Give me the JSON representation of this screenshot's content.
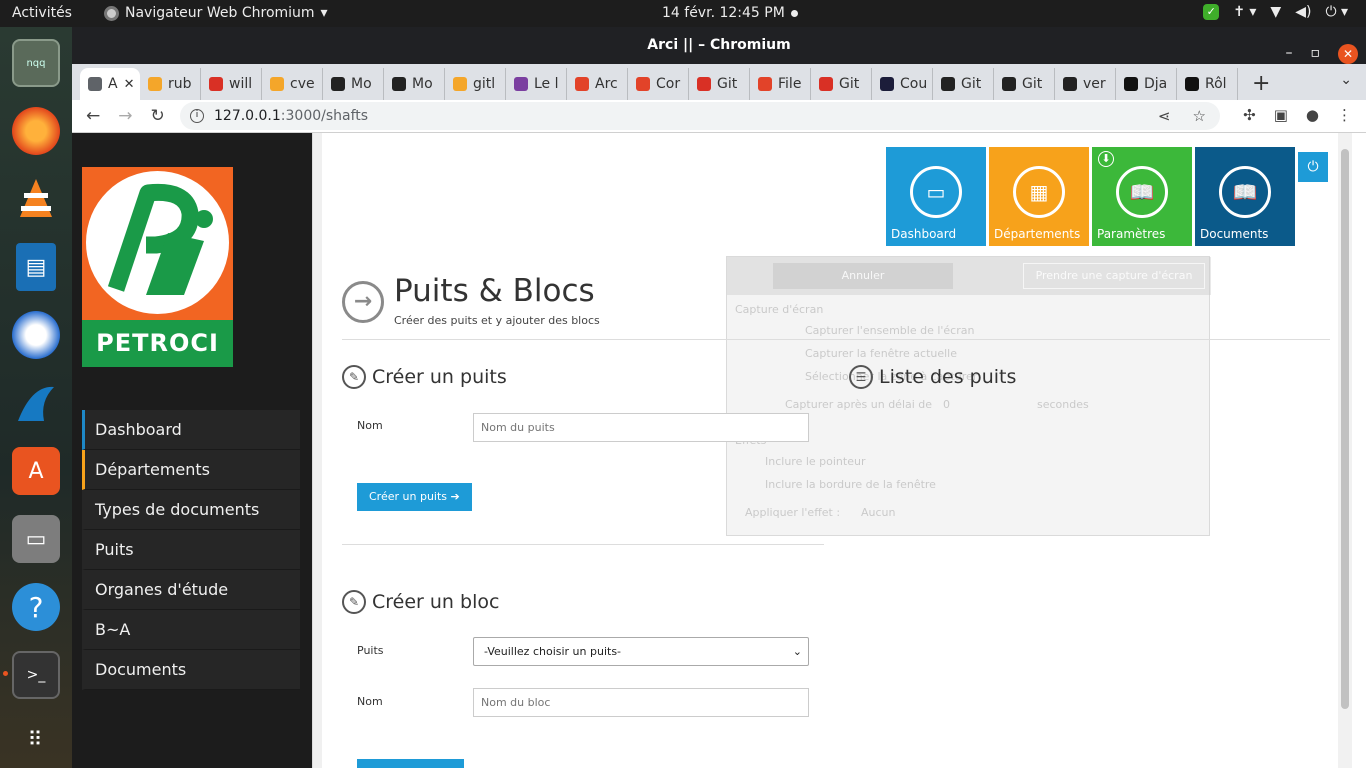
{
  "system": {
    "activities": "Activités",
    "app_menu": "Navigateur Web Chromium",
    "clock": "14 févr.  12:45 PM"
  },
  "dock": {
    "items": [
      "nqq-icon",
      "firefox-icon",
      "vlc-icon",
      "writer-icon",
      "thunderbird-icon",
      "wireshark-icon",
      "software-icon",
      "files-icon",
      "help-icon",
      "terminal-icon",
      "apps-grid-icon"
    ],
    "nqq_label": "nqq"
  },
  "browser": {
    "window_title": "Arci || – Chromium",
    "tabs": [
      {
        "label": "A",
        "color": "#5f6368",
        "active": true
      },
      {
        "label": "rub",
        "color": "#f4a62a"
      },
      {
        "label": "will",
        "color": "#d93025"
      },
      {
        "label": "cve",
        "color": "#f4a62a"
      },
      {
        "label": "Mo",
        "color": "#222222"
      },
      {
        "label": "Mo",
        "color": "#222222"
      },
      {
        "label": "gitl",
        "color": "#f4a62a"
      },
      {
        "label": "Le l",
        "color": "#7b3fa0"
      },
      {
        "label": "Arc",
        "color": "#e24329"
      },
      {
        "label": "Cor",
        "color": "#e24329"
      },
      {
        "label": "Git",
        "color": "#d93025"
      },
      {
        "label": "File",
        "color": "#e24329"
      },
      {
        "label": "Git",
        "color": "#d93025"
      },
      {
        "label": "Cou",
        "color": "#1c1d3a"
      },
      {
        "label": "Git",
        "color": "#222222"
      },
      {
        "label": "Git",
        "color": "#222222"
      },
      {
        "label": "ver",
        "color": "#222222"
      },
      {
        "label": "Dja",
        "color": "#111111"
      },
      {
        "label": "Rôl",
        "color": "#111111"
      }
    ],
    "new_tab": "+",
    "url_host": "127.0.0.1",
    "url_path": ":3000/shafts"
  },
  "sidebar": {
    "logo_text": "PETROCI",
    "items": [
      {
        "label": "Dashboard",
        "accent": "blue"
      },
      {
        "label": "Départements",
        "accent": "orange"
      },
      {
        "label": "Types de documents",
        "accent": "none"
      },
      {
        "label": "Puits",
        "accent": "none"
      },
      {
        "label": "Organes d'étude",
        "accent": "none"
      },
      {
        "label": "B~A",
        "accent": "none"
      },
      {
        "label": "Documents",
        "accent": "none"
      }
    ]
  },
  "tiles": [
    {
      "label": "Dashboard",
      "color": "#1e9bd7",
      "icon": "monitor-icon"
    },
    {
      "label": "Départements",
      "color": "#f7a21b",
      "icon": "grid-icon"
    },
    {
      "label": "Paramètres",
      "color": "#3cb83a",
      "icon": "book-icon"
    },
    {
      "label": "Documents",
      "color": "#0b5a8a",
      "icon": "book-icon"
    }
  ],
  "page": {
    "title": "Puits & Blocs",
    "subtitle": "Créer des puits et y ajouter des blocs",
    "create_well": {
      "title": "Créer un puits",
      "name_label": "Nom",
      "name_placeholder": "Nom du puits",
      "button": "Créer un puits"
    },
    "list_wells": {
      "title": "Liste des puits"
    },
    "create_block": {
      "title": "Créer un bloc",
      "well_label": "Puits",
      "well_select": "-Veuillez choisir un puits-",
      "name_label": "Nom",
      "name_placeholder": "Nom du bloc"
    }
  },
  "ghost_dialog": {
    "cancel": "Annuler",
    "take": "Prendre une capture d'écran",
    "section_capture": "Capture d'écran",
    "opt_full": "Capturer l'ensemble de l'écran",
    "opt_window": "Capturer la fenêtre actuelle",
    "opt_area": "Sélectionner la zone à capturer",
    "delay_label": "Capturer après un délai de",
    "delay_value": "0",
    "delay_unit": "secondes",
    "effects": "Effets",
    "pointer": "Inclure le pointeur",
    "border": "Inclure la bordure de la fenêtre",
    "apply_effect": "Appliquer l'effet :",
    "effect_value": "Aucun"
  }
}
